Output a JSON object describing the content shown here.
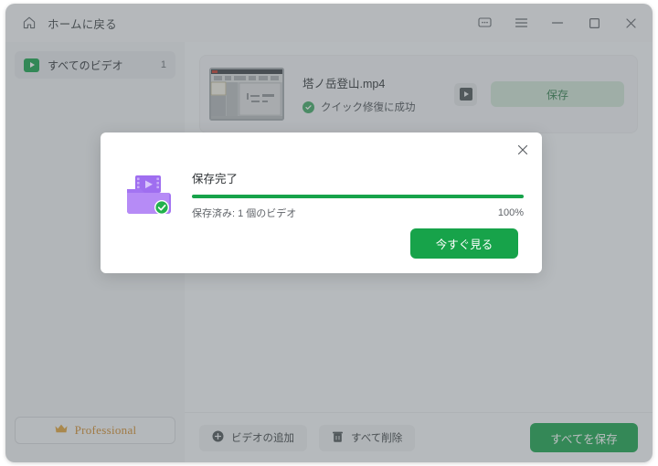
{
  "window": {
    "home_label": "ホームに戻る",
    "icons": {
      "home": "home-icon",
      "feedback": "feedback-icon",
      "menu": "hamburger-menu-icon",
      "minimize": "minimize-icon",
      "maximize": "maximize-icon",
      "close": "close-icon"
    }
  },
  "sidebar": {
    "items": [
      {
        "label": "すべてのビデオ",
        "count": "1",
        "icon": "video-play-icon"
      }
    ],
    "pro_label": "Professional",
    "pro_icon": "crown-icon"
  },
  "main": {
    "videos": [
      {
        "name": "塔ノ岳登山.mp4",
        "status": "クイック修復に成功",
        "status_icon": "check-circle-icon",
        "play_icon": "play-icon",
        "save_label": "保存"
      }
    ]
  },
  "bottom_bar": {
    "add_video_label": "ビデオの追加",
    "add_video_icon": "plus-circle-icon",
    "delete_all_label": "すべて削除",
    "delete_all_icon": "trash-icon",
    "save_all_label": "すべてを保存"
  },
  "modal": {
    "title": "保存完了",
    "progress_label": "保存済み: 1 個のビデオ",
    "progress_percent": "100%",
    "progress_value": 100,
    "action_label": "今すぐ見る",
    "close_icon": "close-icon",
    "folder_icon": "video-folder-success-icon"
  },
  "colors": {
    "accent_green": "#17a34a",
    "soft_green": "#cfe3d5",
    "gold": "#d08a2a",
    "window_bg": "#f4f5f7",
    "sidebar_bg": "#f0f1f3",
    "overlay": "rgba(92,99,106,0.42)"
  }
}
